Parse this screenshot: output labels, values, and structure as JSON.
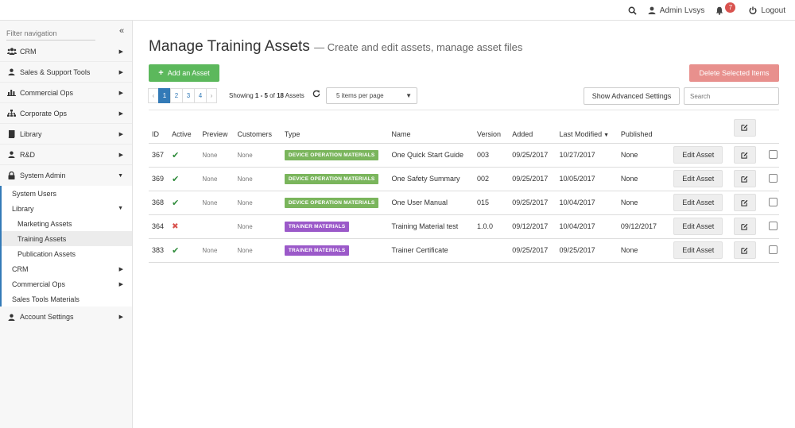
{
  "topbar": {
    "user": "Admin Lvsys",
    "notifications": "7",
    "logout": "Logout"
  },
  "sidebar": {
    "filter_placeholder": "Filter navigation",
    "items": [
      {
        "label": "CRM",
        "icon": "users-icon"
      },
      {
        "label": "Sales & Support Tools",
        "icon": "user-icon"
      },
      {
        "label": "Commercial Ops",
        "icon": "bar-chart-icon"
      },
      {
        "label": "Corporate Ops",
        "icon": "sitemap-icon"
      },
      {
        "label": "Library",
        "icon": "book-icon"
      },
      {
        "label": "R&D",
        "icon": "user-icon"
      },
      {
        "label": "System Admin",
        "icon": "lock-icon"
      }
    ],
    "system_admin": {
      "system_users": "System Users",
      "library": "Library",
      "library_children": [
        "Marketing Assets",
        "Training Assets",
        "Publication Assets"
      ],
      "crm": "CRM",
      "commercial_ops": "Commercial Ops",
      "sales_tools": "Sales Tools Materials"
    },
    "account_settings": "Account Settings"
  },
  "main": {
    "title": "Manage Training Assets",
    "subtitle": "— Create and edit assets, manage asset files",
    "add_button": "Add an Asset",
    "delete_button": "Delete Selected Items",
    "pages": [
      "1",
      "2",
      "3",
      "4"
    ],
    "showing_prefix": "Showing",
    "showing_range": "1 - 5",
    "showing_of": "of",
    "showing_total": "18",
    "showing_suffix": "Assets",
    "per_page": "5 items per page",
    "advanced_button": "Show Advanced Settings",
    "search_placeholder": "Search",
    "columns": [
      "ID",
      "Active",
      "Preview",
      "Customers",
      "Type",
      "Name",
      "Version",
      "Added",
      "Last Modified",
      "Published"
    ],
    "edit_label": "Edit Asset",
    "rows": [
      {
        "id": "367",
        "active": true,
        "preview": "None",
        "customers": "None",
        "type": "DEVICE OPERATION MATERIALS",
        "type_color": "#7ab55c",
        "name": "One Quick Start Guide",
        "version": "003",
        "added": "09/25/2017",
        "modified": "10/27/2017",
        "published": "None"
      },
      {
        "id": "369",
        "active": true,
        "preview": "None",
        "customers": "None",
        "type": "DEVICE OPERATION MATERIALS",
        "type_color": "#7ab55c",
        "name": "One Safety Summary",
        "version": "002",
        "added": "09/25/2017",
        "modified": "10/05/2017",
        "published": "None"
      },
      {
        "id": "368",
        "active": true,
        "preview": "None",
        "customers": "None",
        "type": "DEVICE OPERATION MATERIALS",
        "type_color": "#7ab55c",
        "name": "One User Manual",
        "version": "015",
        "added": "09/25/2017",
        "modified": "10/04/2017",
        "published": "None"
      },
      {
        "id": "364",
        "active": false,
        "preview": "",
        "customers": "None",
        "type": "TRAINER MATERIALS",
        "type_color": "#9b59c9",
        "name": "Training Material test",
        "version": "1.0.0",
        "added": "09/12/2017",
        "modified": "10/04/2017",
        "published": "09/12/2017"
      },
      {
        "id": "383",
        "active": true,
        "preview": "None",
        "customers": "None",
        "type": "TRAINER MATERIALS",
        "type_color": "#9b59c9",
        "name": "Trainer Certificate",
        "version": "",
        "added": "09/25/2017",
        "modified": "09/25/2017",
        "published": "None"
      }
    ]
  },
  "colors": {
    "primary": "#337ab7",
    "success": "#5cb85c",
    "danger": "#e8908d"
  }
}
